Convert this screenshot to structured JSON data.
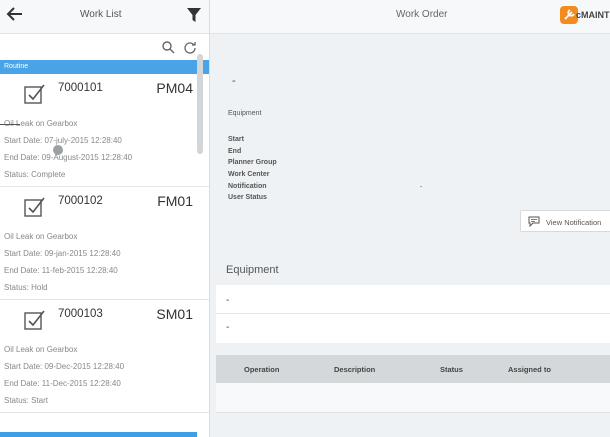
{
  "left_header": {
    "title": "Work List",
    "back_icon": "arrow-left-icon",
    "filter_icon": "filter-icon"
  },
  "search": {
    "search_icon": "search-icon",
    "refresh_icon": "refresh-icon"
  },
  "group": {
    "label": "Routine"
  },
  "work_orders": [
    {
      "number": "7000101",
      "type": "PM04",
      "description": "Oil Leak on Gearbox",
      "start": "Start Date: 07-july-2015 12:28:40",
      "end": "End Date: 09-August-2015 12:28:40",
      "status": "Status: Complete"
    },
    {
      "number": "7000102",
      "type": "FM01",
      "description": "Oil Leak on Gearbox",
      "start": "Start Date: 09-jan-2015 12:28:40",
      "end": "End Date: 11-feb-2015 12:28:40",
      "status": "Status: Hold"
    },
    {
      "number": "7000103",
      "type": "SM01",
      "description": "Oil Leak on Gearbox",
      "start": "Start Date: 09-Dec-2015 12:28:40",
      "end": "End Date: 11-Dec-2015 12:28:40",
      "status": "Status: Start"
    }
  ],
  "right_header": {
    "title": "Work Order",
    "logo_text": "cMAINTENAI"
  },
  "detail": {
    "heading": "-",
    "equipment_label": "Equipment",
    "fields": [
      "Start",
      "End",
      "Planner Group",
      "Work Center",
      "Notification",
      "User Status"
    ],
    "notification_value": "-",
    "view_notification_label": "View Notification"
  },
  "equipment_section": {
    "title": "Equipment",
    "rows": [
      "-",
      "-"
    ]
  },
  "operations": {
    "columns": [
      "Operation",
      "Description",
      "Status",
      "Assigned to"
    ]
  },
  "colors": {
    "accent": "#4aa3e6",
    "brand": "#f58a1f"
  }
}
